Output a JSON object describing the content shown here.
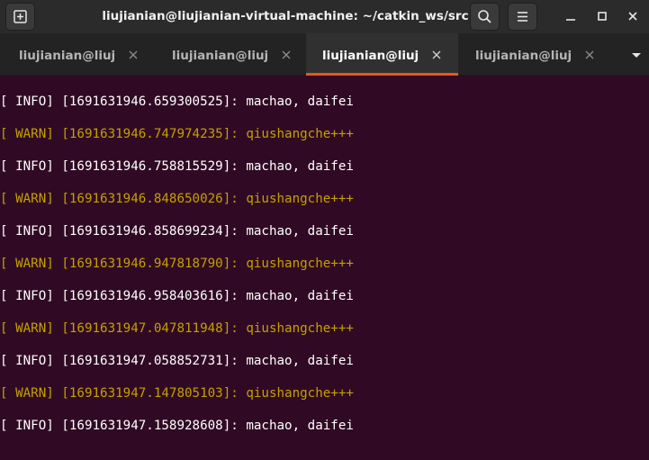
{
  "window": {
    "title": "liujianian@liujianian-virtual-machine: ~/catkin_ws/src"
  },
  "titlebar": {
    "new_tab_icon": "new-tab-icon",
    "search_icon": "search-icon",
    "menu_icon": "hamburger-menu-icon",
    "minimize_icon": "minimize-icon",
    "maximize_icon": "maximize-icon",
    "close_icon": "close-icon"
  },
  "tabs": [
    {
      "label": "liujianian@liuj…",
      "active": false
    },
    {
      "label": "liujianian@liuj…",
      "active": false
    },
    {
      "label": "liujianian@liuj…",
      "active": true
    },
    {
      "label": "liujianian@liuj…",
      "active": false
    }
  ],
  "colors": {
    "terminal_background": "#300a24",
    "info_text": "#ffffff",
    "warn_text": "#c4a000",
    "active_tab_accent": "#e95420"
  },
  "terminal": {
    "lines": [
      {
        "level": "info",
        "text": "[ INFO] [1691631946.659300525]: machao, daifei"
      },
      {
        "level": "warn",
        "text": "[ WARN] [1691631946.747974235]: qiushangche+++"
      },
      {
        "level": "info",
        "text": "[ INFO] [1691631946.758815529]: machao, daifei"
      },
      {
        "level": "warn",
        "text": "[ WARN] [1691631946.848650026]: qiushangche+++"
      },
      {
        "level": "info",
        "text": "[ INFO] [1691631946.858699234]: machao, daifei"
      },
      {
        "level": "warn",
        "text": "[ WARN] [1691631946.947818790]: qiushangche+++"
      },
      {
        "level": "info",
        "text": "[ INFO] [1691631946.958403616]: machao, daifei"
      },
      {
        "level": "warn",
        "text": "[ WARN] [1691631947.047811948]: qiushangche+++"
      },
      {
        "level": "info",
        "text": "[ INFO] [1691631947.058852731]: machao, daifei"
      },
      {
        "level": "warn",
        "text": "[ WARN] [1691631947.147805103]: qiushangche+++"
      },
      {
        "level": "info",
        "text": "[ INFO] [1691631947.158928608]: machao, daifei"
      }
    ]
  }
}
